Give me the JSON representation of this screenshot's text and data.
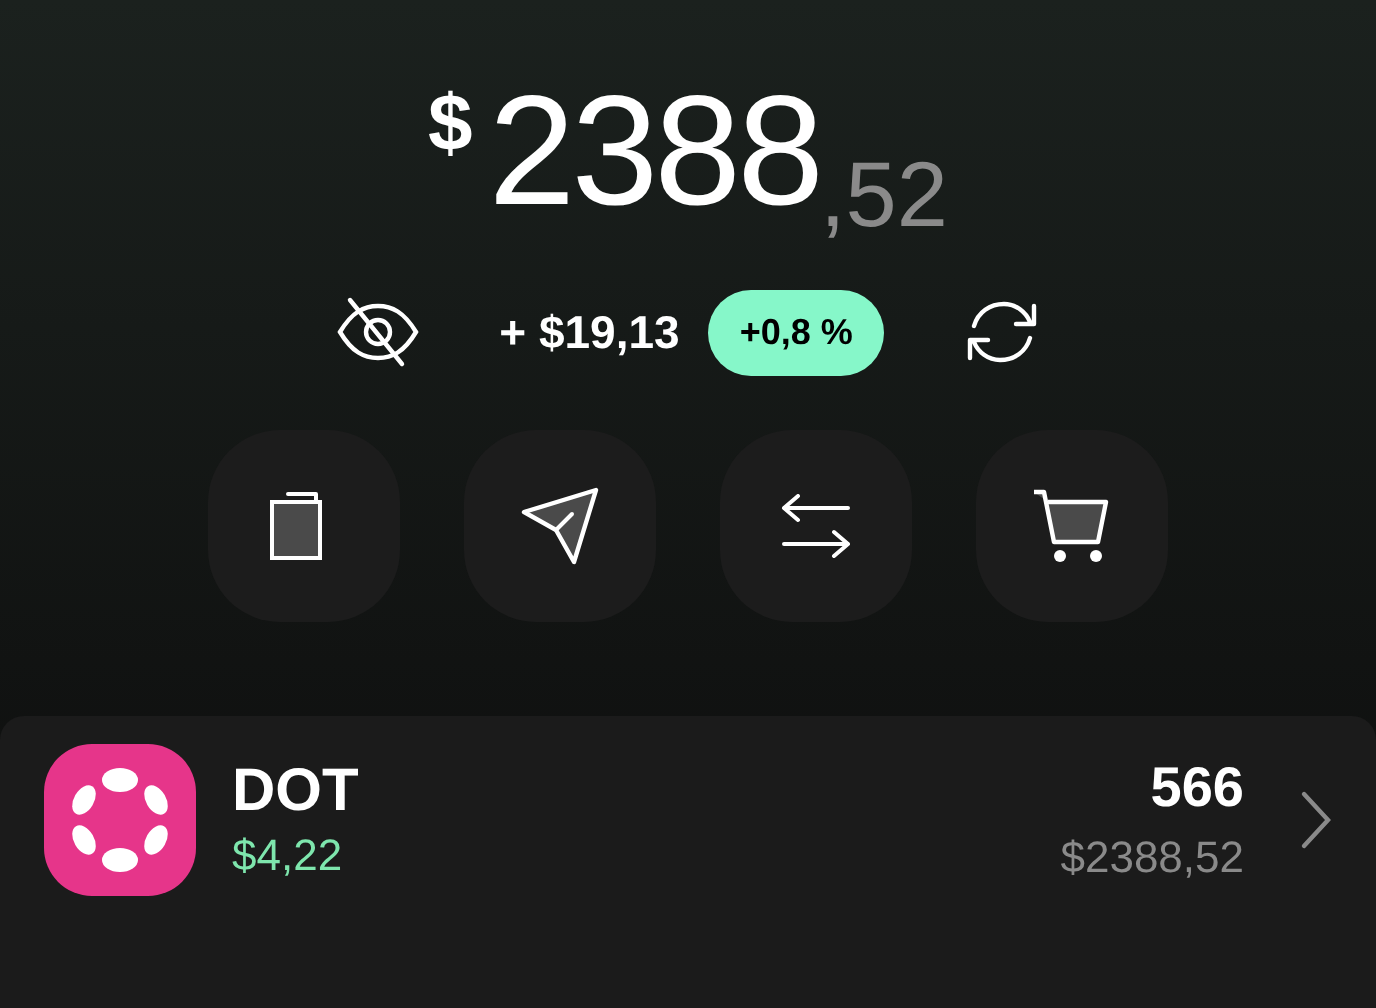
{
  "balance": {
    "currency": "$",
    "whole": "2388",
    "fraction": ",52"
  },
  "change": {
    "amount": "+ $19,13",
    "percent": "+0,8 %",
    "hidden": true
  },
  "actions": [
    {
      "kind": "copy"
    },
    {
      "kind": "send"
    },
    {
      "kind": "swap"
    },
    {
      "kind": "buy"
    }
  ],
  "assets": [
    {
      "symbol": "DOT",
      "price": "$4,22",
      "amount": "566",
      "value": "$2388,52",
      "color": "#e6358a"
    }
  ]
}
